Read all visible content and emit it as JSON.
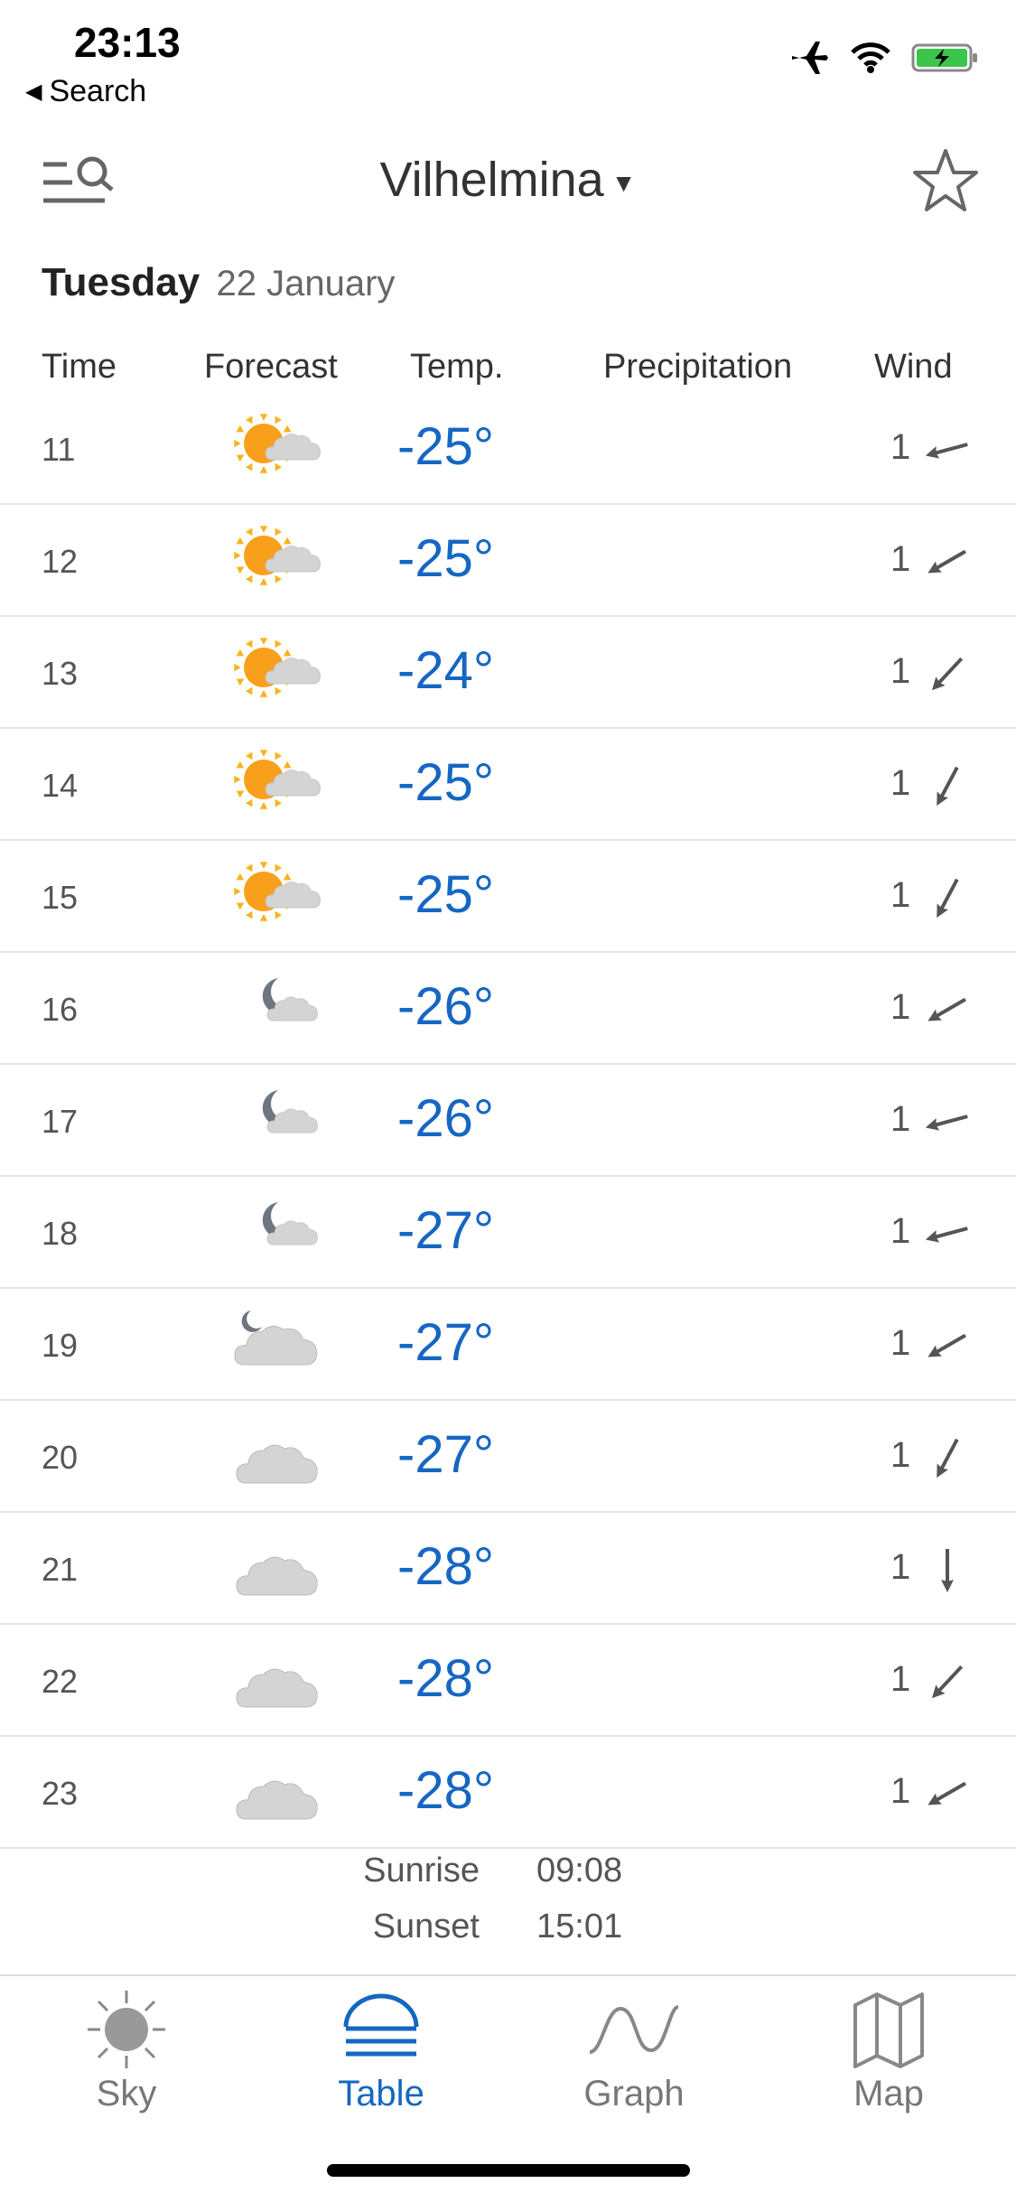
{
  "status": {
    "time": "23:13",
    "back_label": "Search",
    "icons": [
      "airplane-icon",
      "wifi-icon",
      "battery-charging-icon"
    ]
  },
  "header": {
    "location": "Vilhelmina",
    "menu_icon": "menu-search-icon",
    "favorite_icon": "star-icon"
  },
  "date": {
    "day": "Tuesday",
    "date": "22 January"
  },
  "columns": {
    "time": "Time",
    "forecast": "Forecast",
    "temp": "Temp.",
    "precipitation": "Precipitation",
    "wind": "Wind"
  },
  "rows": [
    {
      "time": "11",
      "icon": "sun-cloud",
      "temp": "-25°",
      "wind": "1",
      "wind_dir": "W"
    },
    {
      "time": "12",
      "icon": "sun-cloud",
      "temp": "-25°",
      "wind": "1",
      "wind_dir": "WSW"
    },
    {
      "time": "13",
      "icon": "sun-cloud",
      "temp": "-24°",
      "wind": "1",
      "wind_dir": "SW"
    },
    {
      "time": "14",
      "icon": "sun-cloud",
      "temp": "-25°",
      "wind": "1",
      "wind_dir": "SSW"
    },
    {
      "time": "15",
      "icon": "sun-cloud",
      "temp": "-25°",
      "wind": "1",
      "wind_dir": "SSW"
    },
    {
      "time": "16",
      "icon": "moon-cloud",
      "temp": "-26°",
      "wind": "1",
      "wind_dir": "WSW"
    },
    {
      "time": "17",
      "icon": "moon-cloud",
      "temp": "-26°",
      "wind": "1",
      "wind_dir": "W"
    },
    {
      "time": "18",
      "icon": "moon-cloud",
      "temp": "-27°",
      "wind": "1",
      "wind_dir": "W"
    },
    {
      "time": "19",
      "icon": "moon-cloudy",
      "temp": "-27°",
      "wind": "1",
      "wind_dir": "WSW"
    },
    {
      "time": "20",
      "icon": "cloud",
      "temp": "-27°",
      "wind": "1",
      "wind_dir": "SSW"
    },
    {
      "time": "21",
      "icon": "cloud",
      "temp": "-28°",
      "wind": "1",
      "wind_dir": "S"
    },
    {
      "time": "22",
      "icon": "cloud",
      "temp": "-28°",
      "wind": "1",
      "wind_dir": "SW"
    },
    {
      "time": "23",
      "icon": "cloud",
      "temp": "-28°",
      "wind": "1",
      "wind_dir": "WSW"
    }
  ],
  "sun": {
    "sunrise_label": "Sunrise",
    "sunrise": "09:08",
    "sunset_label": "Sunset",
    "sunset": "15:01"
  },
  "tabs": [
    {
      "label": "Sky",
      "icon": "sun-icon",
      "active": false
    },
    {
      "label": "Table",
      "icon": "table-icon",
      "active": true
    },
    {
      "label": "Graph",
      "icon": "graph-icon",
      "active": false
    },
    {
      "label": "Map",
      "icon": "map-icon",
      "active": false
    }
  ],
  "colors": {
    "accent": "#1567c1",
    "sun": "#f9b321",
    "cloud": "#cfcfcf",
    "moon": "#6f7580"
  }
}
